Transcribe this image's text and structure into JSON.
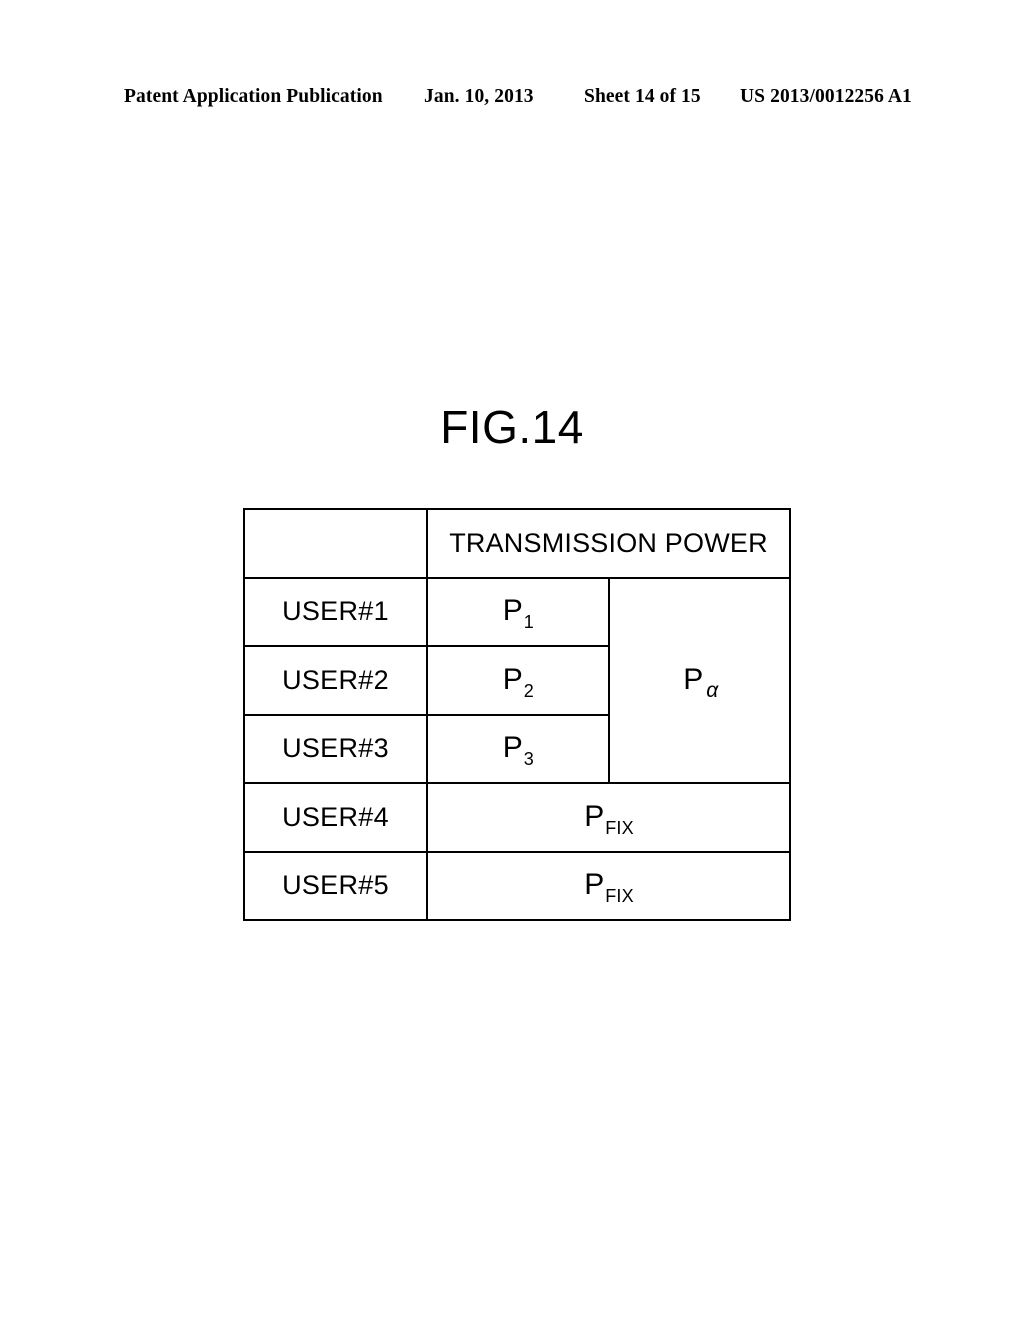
{
  "header": {
    "publication": "Patent Application Publication",
    "date": "Jan. 10, 2013",
    "sheet": "Sheet 14 of 15",
    "patent_number": "US 2013/0012256 A1"
  },
  "figure": {
    "title": "FIG.14"
  },
  "table": {
    "corner_cell": "",
    "column_header": "TRANSMISSION POWER",
    "rows": [
      {
        "user": "USER#1",
        "power_base": "P",
        "power_sub": "1"
      },
      {
        "user": "USER#2",
        "power_base": "P",
        "power_sub": "2"
      },
      {
        "user": "USER#3",
        "power_base": "P",
        "power_sub": "3"
      },
      {
        "user": "USER#4",
        "power_base": "P",
        "power_sub": "FIX"
      },
      {
        "user": "USER#5",
        "power_base": "P",
        "power_sub": "FIX"
      }
    ],
    "grouped_power": {
      "base": "P",
      "sub": "α"
    }
  }
}
